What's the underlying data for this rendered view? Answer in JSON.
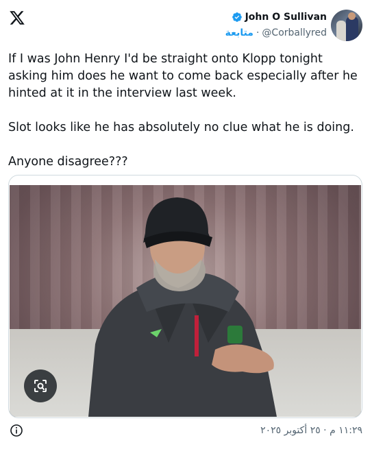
{
  "header": {
    "logo_icon": "x-logo-icon"
  },
  "author": {
    "display_name": "John O Sullivan",
    "verified_icon": "verified-badge-icon",
    "handle": "@Corballyred",
    "separator": "·",
    "follow_label": "متابعة",
    "avatar": "avatar"
  },
  "tweet": {
    "text": "If I was John Henry I'd be straight onto Klopp tonight asking him does he want to come back especially after he hinted at it in the interview last week.\n\nSlot looks like he has absolutely no clue what he is doing.\n\nAnyone disagree???"
  },
  "media": {
    "photo": "photo-klopp",
    "camera_icon": "visual-search-icon"
  },
  "footer": {
    "timestamp": "١١:٢٩ م · ٢٥ أكتوبر ٢٠٢٥",
    "info_icon": "info-icon"
  },
  "colors": {
    "accent": "#1d9bf0",
    "text": "#0f1419",
    "muted": "#536471",
    "border": "#cfd9de"
  }
}
